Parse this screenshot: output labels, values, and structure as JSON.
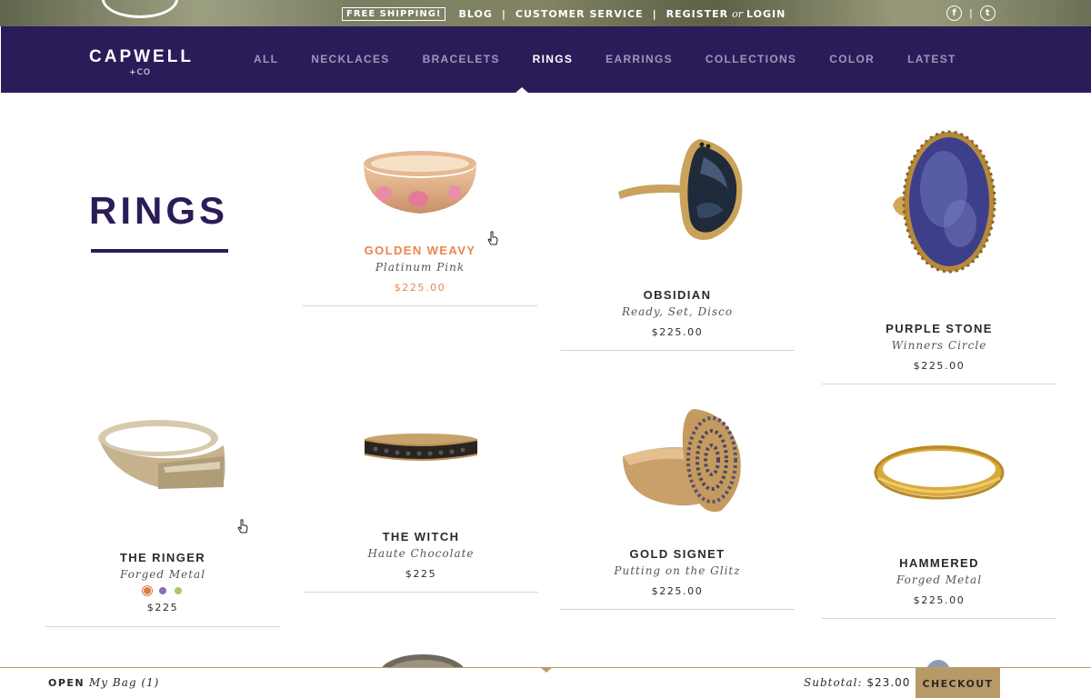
{
  "topbar": {
    "free_shipping": "FREE SHIPPING!",
    "blog": "BLOG",
    "customer_service": "CUSTOMER SERVICE",
    "register": "REGISTER",
    "or": "or",
    "login": "LOGIN",
    "facebook_glyph": "f",
    "twitter_glyph": "t"
  },
  "brand": {
    "name": "CAPWELL",
    "sub": "+CO"
  },
  "nav": {
    "items": [
      "ALL",
      "NECKLACES",
      "BRACELETS",
      "RINGS",
      "EARRINGS",
      "COLLECTIONS",
      "COLOR",
      "LATEST"
    ],
    "active": "RINGS"
  },
  "page": {
    "title": "RINGS"
  },
  "products": [
    {
      "name": "GOLDEN WEAVY",
      "subtitle": "Platinum Pink",
      "price": "$225.00",
      "highlight": true
    },
    {
      "name": "OBSIDIAN",
      "subtitle": "Ready, Set, Disco",
      "price": "$225.00"
    },
    {
      "name": "PURPLE STONE",
      "subtitle": "Winners Circle",
      "price": "$225.00"
    },
    {
      "name": "THE RINGER",
      "subtitle": "Forged Metal",
      "price": "$225",
      "swatches": [
        "#e07a45",
        "#8b6bb1",
        "#a9c76a"
      ]
    },
    {
      "name": "THE WITCH",
      "subtitle": "Haute Chocolate",
      "price": "$225"
    },
    {
      "name": "GOLD SIGNET",
      "subtitle": "Putting on the Glitz",
      "price": "$225.00"
    },
    {
      "name": "HAMMERED",
      "subtitle": "Forged Metal",
      "price": "$225.00"
    }
  ],
  "bag": {
    "open_label": "OPEN",
    "bag_label": "My Bag (1)",
    "subtotal_label": "Subtotal:",
    "subtotal_value": "$23.00",
    "checkout_label": "CHECKOUT"
  },
  "colors": {
    "nav_bg": "#2b1c59",
    "accent": "#e8854f",
    "checkout": "#b89a68"
  }
}
